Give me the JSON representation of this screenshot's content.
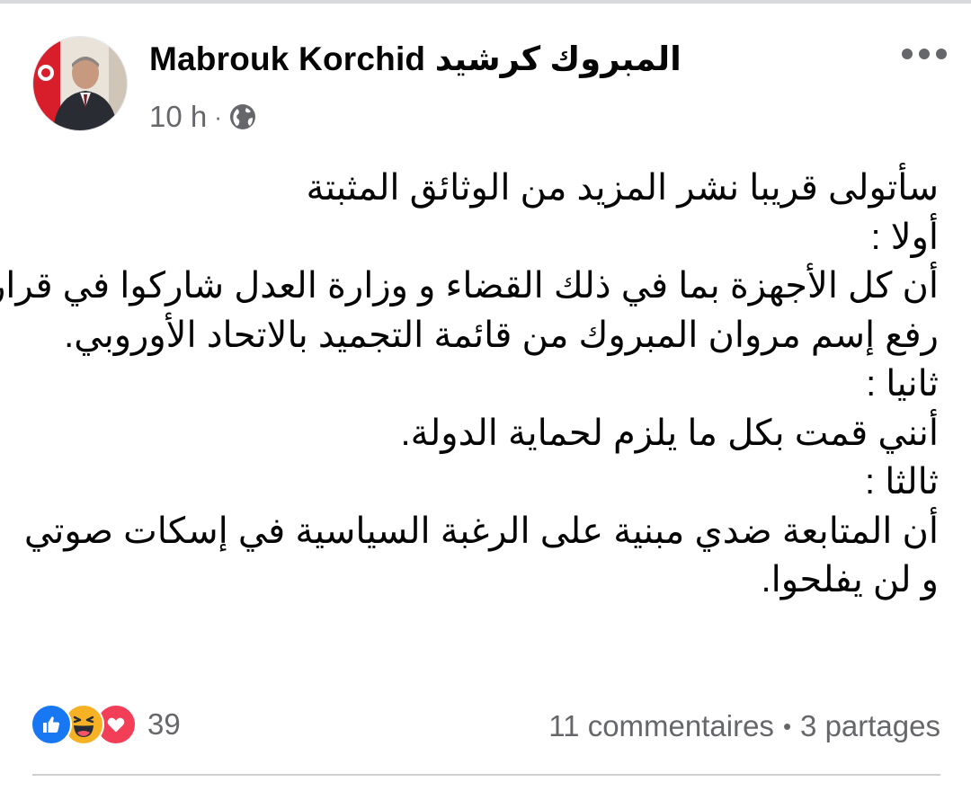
{
  "post": {
    "author": "Mabrouk Korchid المبروك كرشيد",
    "time": "10 h",
    "meta_separator": "·",
    "audience_icon": "globe-icon",
    "more_icon": "more-options-icon",
    "avatar_icon": "profile-photo-avatar",
    "body_lines": [
      "سأتولى قريبا نشر المزيد من الوثائق المثبتة",
      "أولا :",
      "أن كل الأجهزة بما في ذلك القضاء و وزارة العدل شاركوا في قرار",
      "رفع إسم مروان المبروك من قائمة التجميد بالاتحاد الأوروبي.",
      "ثانيا :",
      "أنني قمت بكل ما يلزم لحماية الدولة.",
      "ثالثا :",
      "أن المتابعة ضدي مبنية على الرغبة السياسية في إسكات صوتي",
      "و لن يفلحوا."
    ]
  },
  "reactions": {
    "icons": [
      "like-icon",
      "haha-icon",
      "love-icon"
    ],
    "count": "39"
  },
  "engagement": {
    "comments": "11 commentaires",
    "separator": "•",
    "shares": "3 partages"
  },
  "colors": {
    "like_blue": "#1877f2",
    "love_red": "#f33e58",
    "haha_yellow": "#f7b125",
    "secondary_text": "#65676b",
    "primary_text": "#050505"
  }
}
